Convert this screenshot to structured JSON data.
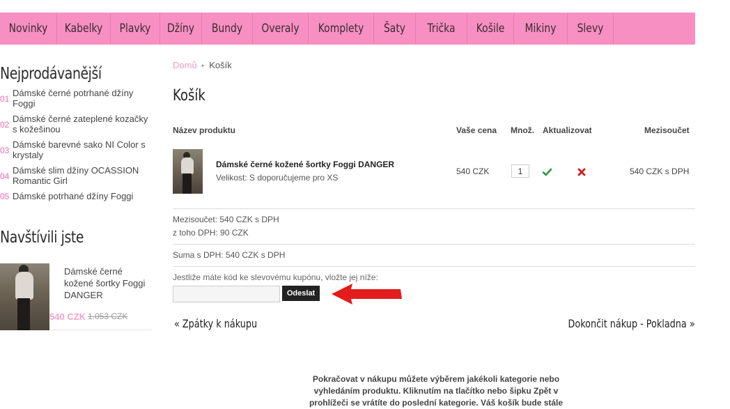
{
  "nav": {
    "items": [
      "Novinky",
      "Kabelky",
      "Plavky",
      "Džíny",
      "Bundy",
      "Overaly",
      "Komplety",
      "Šaty",
      "Trička",
      "Košile",
      "Mikiny",
      "Slevy"
    ]
  },
  "sidebar": {
    "bestsellers_title": "Nejprodávanější",
    "bestsellers": [
      {
        "num": "01",
        "name": "Dámské černé potrhané džíny Foggi"
      },
      {
        "num": "02",
        "name": "Dámské černé zateplené kozačky s kožešinou"
      },
      {
        "num": "03",
        "name": "Dámské barevné sako NI Color s krystaly"
      },
      {
        "num": "04",
        "name": "Dámské slim džíny OCASSION Romantic Girl"
      },
      {
        "num": "05",
        "name": "Dámské potrhané džíny Foggi"
      }
    ],
    "visited_title": "Navštívili jste",
    "visited": {
      "name": "Dámské černé kožené šortky Foggi DANGER",
      "price": "540 CZK",
      "old_price": "1.053 CZK"
    }
  },
  "breadcrumb": {
    "home": "Domů",
    "sep": "▸",
    "current": "Košík"
  },
  "page_title": "Košík",
  "cart": {
    "headers": {
      "product": "Název produktu",
      "price": "Vaše cena",
      "qty": "Množ.",
      "update": "Aktualizovat",
      "subtotal": "Mezisoučet"
    },
    "item": {
      "name": "Dámské černé kožené šortky Foggi DANGER",
      "variant": "Velikost: S doporučujeme pro XS",
      "price": "540 CZK",
      "qty": "1",
      "subtotal": "540 CZK s DPH"
    },
    "summary": {
      "subtotal": "Mezisoučet: 540 CZK s DPH",
      "vat": "z toho DPH: 90 CZK",
      "total": "Suma s DPH: 540 CZK s DPH"
    },
    "coupon": {
      "label": "Jestliže máte kód ke slevovému kupónu, vložte jej níže:",
      "placeholder": "",
      "button": "Odeslat"
    },
    "back_link": "« Zpátky k nákupu",
    "checkout_link": "Dokončit nákup - Pokladna »"
  },
  "info_text": "Pokračovat v nákupu můžete výběrem jakékoli kategorie nebo vyhledáním produktu. Kliknutím na tlačítko nebo šipku Zpět v prohlížeči se vrátíte do poslední kategorie. Váš košík bude stále",
  "colors": {
    "nav_bg": "#f78fc2",
    "accent_pink": "#f06ab0",
    "arrow_red": "#e31c1c",
    "ok_green": "#3a9a3a",
    "del_red": "#d11a1a"
  },
  "icons": {
    "update": "check-icon",
    "remove": "cross-icon",
    "annotation": "red-arrow-icon"
  }
}
